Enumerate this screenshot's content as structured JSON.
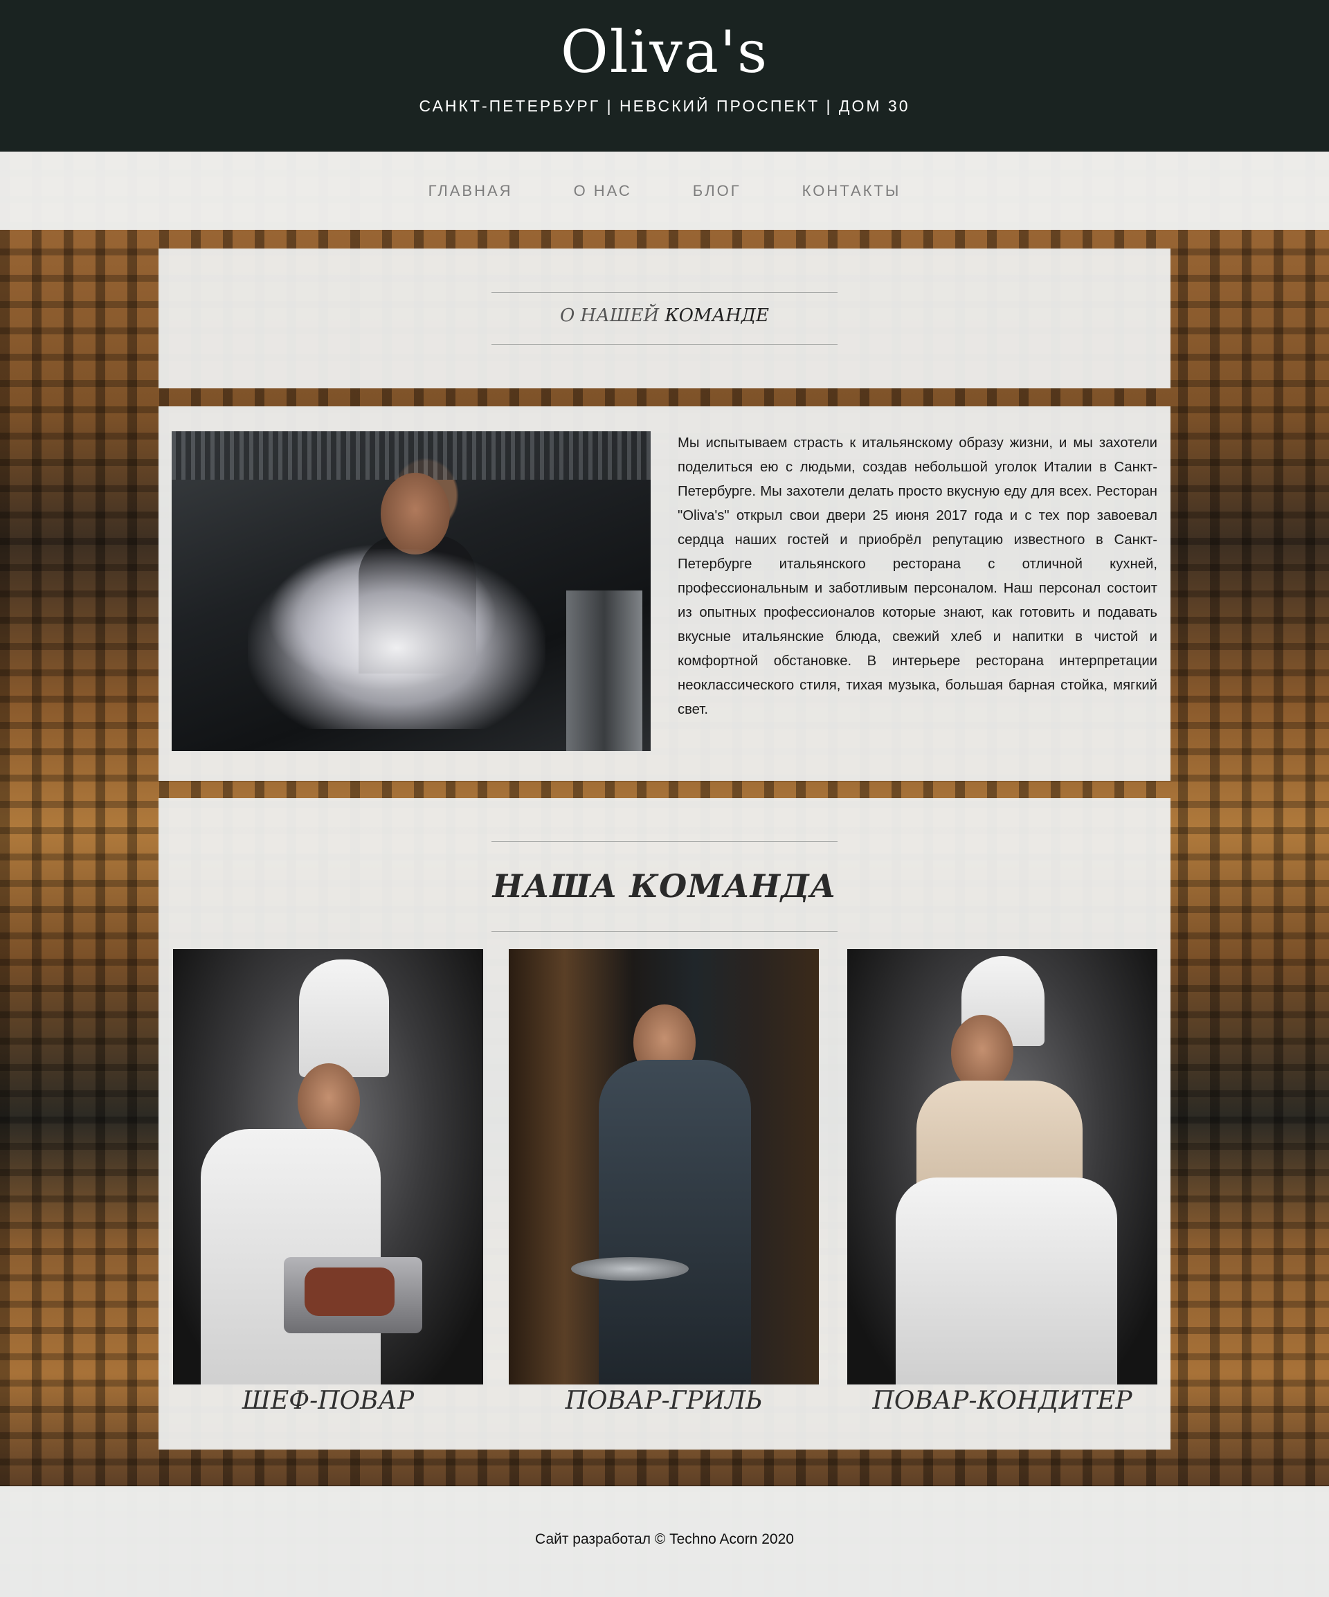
{
  "header": {
    "title": "Oliva's",
    "address": "САНКТ-ПЕТЕРБУРГ | НЕВСКИЙ ПРОСПЕКТ | ДОМ 30"
  },
  "nav": {
    "items": [
      {
        "label": "ГЛАВНАЯ"
      },
      {
        "label": "О НАС"
      },
      {
        "label": "БЛОГ"
      },
      {
        "label": "КОНТАКТЫ"
      }
    ]
  },
  "about": {
    "heading_light": "О НАШЕЙ ",
    "heading_strong": "КОМАНДЕ",
    "text": "Мы испытываем страсть к итальянскому образу жизни, и мы захотели поделиться ею с людьми, создав небольшой уголок Италии в Санкт-Петербурге. Мы захотели делать просто вкусную еду для всех. Ресторан \"Oliva's\" открыл свои двери 25 июня 2017 года и с тех пор завоевал сердца наших гостей и приобрёл репутацию известного в Санкт-Петербурге итальянского ресторана с отличной кухней, профессиональным и заботливым персоналом. Наш персонал состоит из опытных профессионалов которые знают, как готовить и подавать вкусные итальянские блюда, свежий хлеб и напитки в чистой и комфортной обстановке. В интерьере ресторана интерпретации неоклассического стиля, тихая музыка, большая барная стойка, мягкий свет."
  },
  "team": {
    "heading": "НАША КОМАНДА",
    "members": [
      {
        "title": "ШЕФ-ПОВАР"
      },
      {
        "title": "ПОВАР-ГРИЛЬ"
      },
      {
        "title": "ПОВАР-КОНДИТЕР"
      }
    ]
  },
  "footer": {
    "text": "Сайт разработал © Techno Acorn 2020"
  },
  "colors": {
    "header_bg": "#1a2321",
    "panel_bg": "#eeefee",
    "nav_text": "#7d7d7d"
  }
}
